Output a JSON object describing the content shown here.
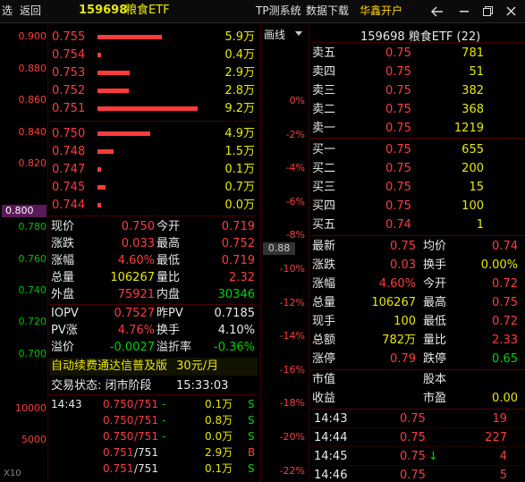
{
  "topbar": {
    "btn_select": "选",
    "btn_back": "返回",
    "code": "159698",
    "name": "粮食ETF",
    "menu_platform": "TP测系统",
    "menu_download": "数据下载",
    "menu_broker": "华鑫开户"
  },
  "axis": {
    "labels": [
      "0.900",
      "0.880",
      "0.860",
      "0.840",
      "0.820",
      "0.800",
      "0.780",
      "0.760",
      "0.740",
      "0.720",
      "0.700",
      "10000",
      "5000"
    ],
    "current": "0.800",
    "scale": "X10"
  },
  "asks": [
    {
      "price": "0.755",
      "vol": "5.9万",
      "ratio": 0.64
    },
    {
      "price": "0.754",
      "vol": "0.4万",
      "ratio": 0.04
    },
    {
      "price": "0.753",
      "vol": "2.9万",
      "ratio": 0.32
    },
    {
      "price": "0.752",
      "vol": "2.8万",
      "ratio": 0.31
    },
    {
      "price": "0.751",
      "vol": "9.2万",
      "ratio": 1.0
    }
  ],
  "bids": [
    {
      "price": "0.750",
      "vol": "4.9万",
      "ratio": 0.53
    },
    {
      "price": "0.748",
      "vol": "1.5万",
      "ratio": 0.16
    },
    {
      "price": "0.747",
      "vol": "0.1万",
      "ratio": 0.02
    },
    {
      "price": "0.745",
      "vol": "0.7万",
      "ratio": 0.08
    },
    {
      "price": "0.744",
      "vol": "0.0万",
      "ratio": 0.01
    }
  ],
  "quote": {
    "l_xj": "现价",
    "v_xj": "0.750",
    "l_jk": "今开",
    "v_jk": "0.719",
    "l_zd": "涨跌",
    "v_zd": "0.033",
    "l_zg": "最高",
    "v_zg": "0.752",
    "l_zf": "涨幅",
    "v_zf": "4.60%",
    "l_zdi": "最低",
    "v_zdi": "0.719",
    "l_zl": "总量",
    "v_zl": "106267",
    "l_lb": "量比",
    "v_lb": "2.32",
    "l_wp": "外盘",
    "v_wp": "75921",
    "l_np": "内盘",
    "v_np": "30346"
  },
  "iopv": {
    "l_iopv": "IOPV",
    "v_iopv": "0.7527",
    "l_zpv": "昨PV",
    "v_zpv": "0.7185",
    "l_pvz": "PV涨",
    "v_pvz": "4.76%",
    "l_hs": "换手",
    "v_hs": "4.10%",
    "l_yj": "溢价",
    "v_yj": "-0.0027",
    "l_yjl": "溢折率",
    "v_yjl": "-0.36%"
  },
  "ad": {
    "text": "自动续费通达信普及版",
    "price": "30元/月"
  },
  "trade_status": {
    "label": "交易状态: 闭市阶段",
    "time": "15:33:03"
  },
  "trades": [
    {
      "time": "14:43",
      "price": "0.750",
      "ask": "/751",
      "sign": "-",
      "vol": "0.1万",
      "flag": "S"
    },
    {
      "time": "",
      "price": "0.750",
      "ask": "/751",
      "sign": "-",
      "vol": "0.8万",
      "flag": "S"
    },
    {
      "time": "",
      "price": "0.750",
      "ask": "/751",
      "sign": "-",
      "vol": "0.0万",
      "flag": "S"
    },
    {
      "time": "",
      "price": "0.751",
      "ask": "/751",
      "sign": "",
      "vol": "2.9万",
      "flag": "B"
    },
    {
      "time": "",
      "price": "0.751",
      "ask": "/751",
      "sign": "",
      "vol": "0.1万",
      "flag": "S"
    }
  ],
  "mid": {
    "tab": "画线",
    "pcts": [
      "0%",
      "-2%",
      "-4%",
      "-6%",
      "-8%",
      "-10%",
      "-12%",
      "-14%",
      "-16%",
      "-18%",
      "-20%",
      "-22%"
    ],
    "vol_label": "0.88"
  },
  "right": {
    "title": "159698 粮食ETF (22)"
  },
  "levels": [
    {
      "label": "卖五",
      "price": "0.75",
      "vol": "781"
    },
    {
      "label": "卖四",
      "price": "0.75",
      "vol": "51"
    },
    {
      "label": "卖三",
      "price": "0.75",
      "vol": "382"
    },
    {
      "label": "卖二",
      "price": "0.75",
      "vol": "368"
    },
    {
      "label": "卖一",
      "price": "0.75",
      "vol": "1219"
    },
    {
      "label": "买一",
      "price": "0.75",
      "vol": "655"
    },
    {
      "label": "买二",
      "price": "0.75",
      "vol": "200"
    },
    {
      "label": "买三",
      "price": "0.75",
      "vol": "15"
    },
    {
      "label": "买四",
      "price": "0.75",
      "vol": "100"
    },
    {
      "label": "买五",
      "price": "0.74",
      "vol": "1"
    }
  ],
  "stats": [
    {
      "l1": "最新",
      "v1": "0.75",
      "l2": "均价",
      "v2": "0.74"
    },
    {
      "l1": "涨跌",
      "v1": "0.03",
      "l2": "换手",
      "v2": "0.00%"
    },
    {
      "l1": "涨幅",
      "v1": "4.60%",
      "l2": "今开",
      "v2": "0.72"
    },
    {
      "l1": "总量",
      "v1": "106267",
      "l2": "最高",
      "v2": "0.75"
    },
    {
      "l1": "现手",
      "v1": "100",
      "l2": "最低",
      "v2": "0.72"
    },
    {
      "l1": "总额",
      "v1": "782万",
      "l2": "量比",
      "v2": "2.33"
    },
    {
      "l1": "涨停",
      "v1": "0.79",
      "l2": "跌停",
      "v2": "0.65"
    }
  ],
  "extra": {
    "l1": "市值",
    "l2": "股本",
    "l3": "收益",
    "l4": "市盈",
    "v4": "0.00"
  },
  "ticks": [
    {
      "time": "14:43",
      "price": "0.75",
      "arrow": "",
      "vol": "19"
    },
    {
      "time": "14:44",
      "price": "0.75",
      "arrow": "",
      "vol": "227"
    },
    {
      "time": "14:45",
      "price": "0.75",
      "arrow": "↓",
      "vol": "4"
    },
    {
      "time": "14:46",
      "price": "0.75",
      "arrow": "",
      "vol": "5"
    }
  ]
}
